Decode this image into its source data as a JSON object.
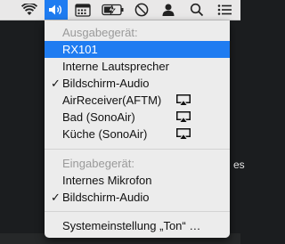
{
  "menubar": {
    "icons": [
      "wifi-icon",
      "volume-icon",
      "calendar-icon",
      "battery-charging-icon",
      "do-not-disturb-icon",
      "user-icon",
      "search-icon",
      "list-icon"
    ]
  },
  "menu": {
    "output_header": "Ausgabegerät:",
    "output_devices": [
      {
        "label": "RX101",
        "selected": false,
        "highlighted": true,
        "airplay": false
      },
      {
        "label": "Interne Lautsprecher",
        "selected": false,
        "highlighted": false,
        "airplay": false
      },
      {
        "label": "Bildschirm-Audio",
        "selected": true,
        "highlighted": false,
        "airplay": false
      },
      {
        "label": "AirReceiver(AFTM)",
        "selected": false,
        "highlighted": false,
        "airplay": true
      },
      {
        "label": "Bad (SonoAir)",
        "selected": false,
        "highlighted": false,
        "airplay": true
      },
      {
        "label": "Küche (SonoAir)",
        "selected": false,
        "highlighted": false,
        "airplay": true
      }
    ],
    "input_header": "Eingabegerät:",
    "input_devices": [
      {
        "label": "Internes Mikrofon",
        "selected": false
      },
      {
        "label": "Bildschirm-Audio",
        "selected": true
      }
    ],
    "check_mark": "✓",
    "settings_label": "Systemeinstellung „Ton“ …"
  },
  "colors": {
    "accent": "#1f7cf1",
    "menu_bg": "#ececec",
    "header_text": "#9a9a9a"
  }
}
